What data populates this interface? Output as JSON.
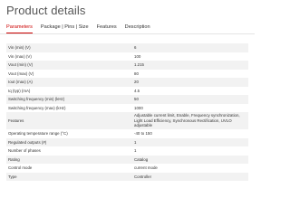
{
  "page": {
    "title": "Product details"
  },
  "tabs": [
    {
      "label": "Parameters",
      "active": true
    },
    {
      "label": "Package | Pins | Size",
      "active": false
    },
    {
      "label": "Features",
      "active": false
    },
    {
      "label": "Description",
      "active": false
    }
  ],
  "specs": [
    {
      "label": "Vin (min) (V)",
      "value": "6"
    },
    {
      "label": "Vin (max) (V)",
      "value": "100"
    },
    {
      "label": "Vout (min) (V)",
      "value": "1.215"
    },
    {
      "label": "Vout (max) (V)",
      "value": "80"
    },
    {
      "label": "Iout (max) (A)",
      "value": "20"
    },
    {
      "label": "Iq (typ) (mA)",
      "value": "4.5"
    },
    {
      "label": "Switching frequency (min) (kHz)",
      "value": "50"
    },
    {
      "label": "Switching frequency (max) (kHz)",
      "value": "1000"
    },
    {
      "label": "Features",
      "value": "Adjustable current limit, Enable, Frequency synchronization, Light Load Efficiency, Synchronous Rectification, UVLO adjustable"
    },
    {
      "label": "Operating temperature range (°C)",
      "value": "-40 to 150"
    },
    {
      "label": "Regulated outputs (#)",
      "value": "1"
    },
    {
      "label": "Number of phases",
      "value": "1"
    },
    {
      "label": "Rating",
      "value": "Catalog"
    },
    {
      "label": "Control mode",
      "value": "current mode"
    },
    {
      "label": "Type",
      "value": "Controller"
    }
  ],
  "colors": {
    "accent": "#cc0000",
    "row_stripe": "#f2f2f2"
  }
}
